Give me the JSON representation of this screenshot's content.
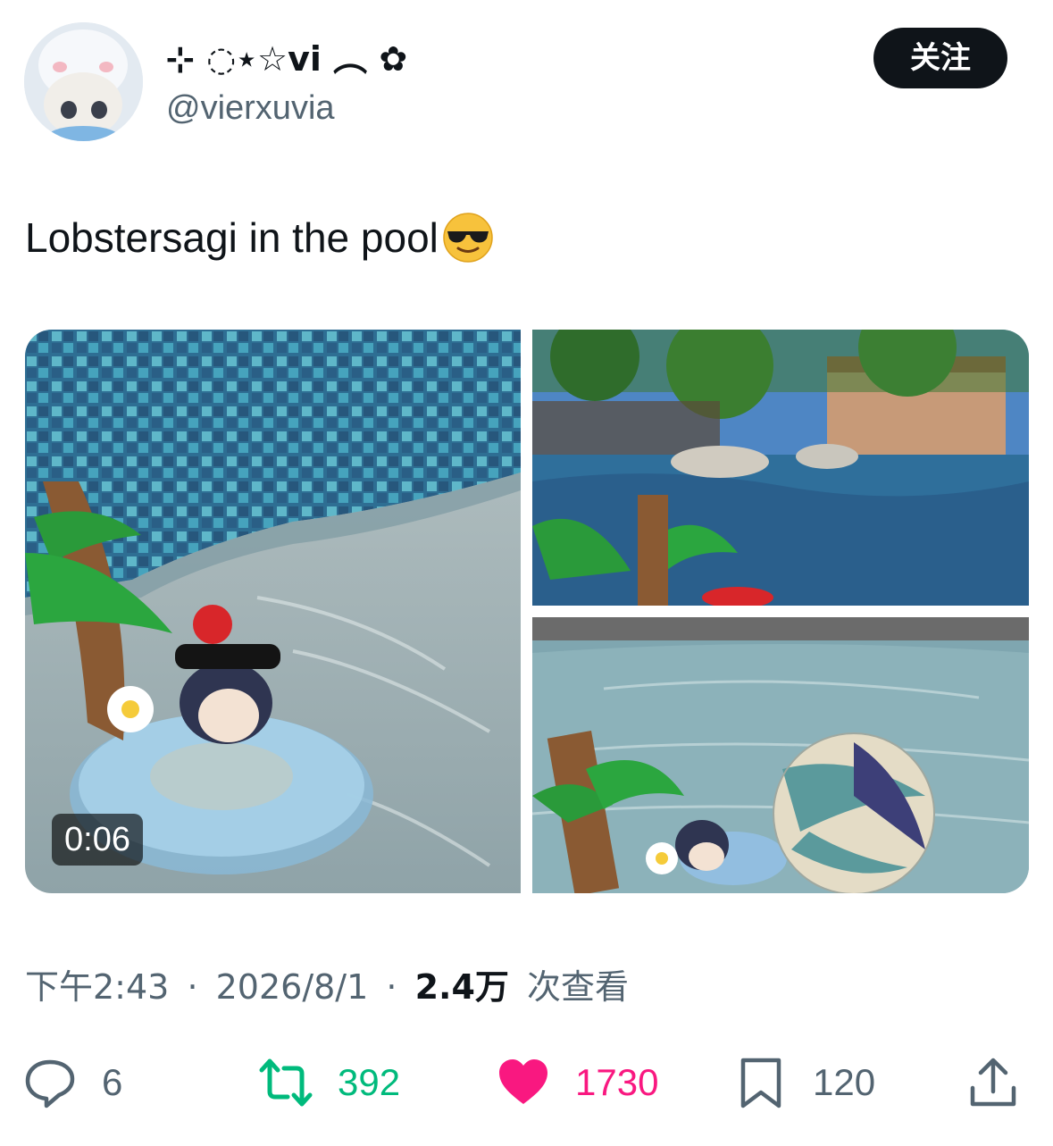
{
  "author": {
    "display_name": "⊹ ◌⋆☆vi ︵ ✿",
    "handle": "@vierxuvia",
    "avatar_icon": "plush-avatar-icon"
  },
  "follow_button": {
    "label": "关注"
  },
  "tweet": {
    "text": "Lobstersagi in the pool",
    "emoji": "smiling-face-with-sunglasses-emoji"
  },
  "media": {
    "video_duration": "0:06"
  },
  "meta": {
    "time": "下午2:43",
    "date": "2026/8/1",
    "separator": "·",
    "views_count": "2.4万",
    "views_label": "次查看"
  },
  "actions": {
    "reply": {
      "count": "6",
      "icon": "reply-icon"
    },
    "retweet": {
      "count": "392",
      "icon": "retweet-icon"
    },
    "like": {
      "count": "1730",
      "icon": "heart-icon"
    },
    "bookmark": {
      "count": "120",
      "icon": "bookmark-icon"
    },
    "share": {
      "icon": "share-icon"
    }
  },
  "colors": {
    "retweet": "#00ba7c",
    "like": "#f91880",
    "secondary_text": "#536471",
    "primary_text": "#0f1419"
  }
}
